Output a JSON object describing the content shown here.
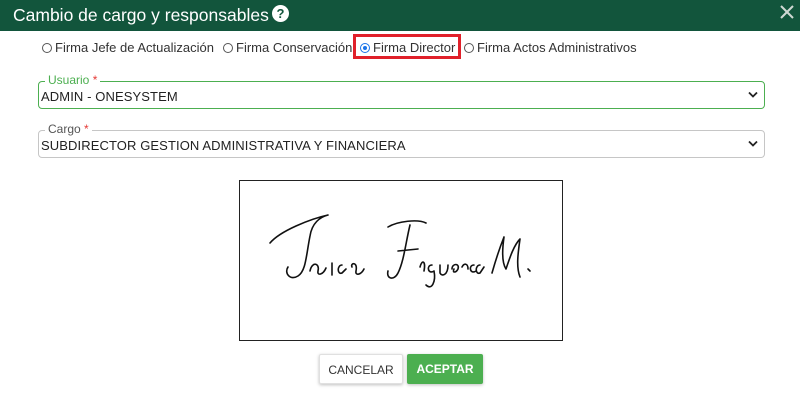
{
  "dialog": {
    "title": "Cambio de cargo y responsables",
    "help_symbol": "?"
  },
  "signature_options": [
    {
      "label": "Firma Jefe de Actualización",
      "checked": false
    },
    {
      "label": "Firma Conservación",
      "checked": false
    },
    {
      "label": "Firma Director",
      "checked": true
    },
    {
      "label": "Firma Actos Administrativos",
      "checked": false
    }
  ],
  "form": {
    "usuario": {
      "label": "Usuario",
      "required_mark": "*",
      "value": "ADMIN - ONESYSTEM"
    },
    "cargo": {
      "label": "Cargo",
      "required_mark": "*",
      "value": "SUBDIRECTOR GESTION ADMINISTRATIVA Y FINANCIERA"
    }
  },
  "signature_image": {
    "signature_text": "Yaira Figueroa M."
  },
  "actions": {
    "cancel_label": "CANCELAR",
    "accept_label": "ACEPTAR"
  },
  "colors": {
    "header_bg": "#12553c",
    "accent_green": "#4caf50",
    "highlight_red": "#e0202a",
    "radio_blue": "#1a73e8"
  }
}
